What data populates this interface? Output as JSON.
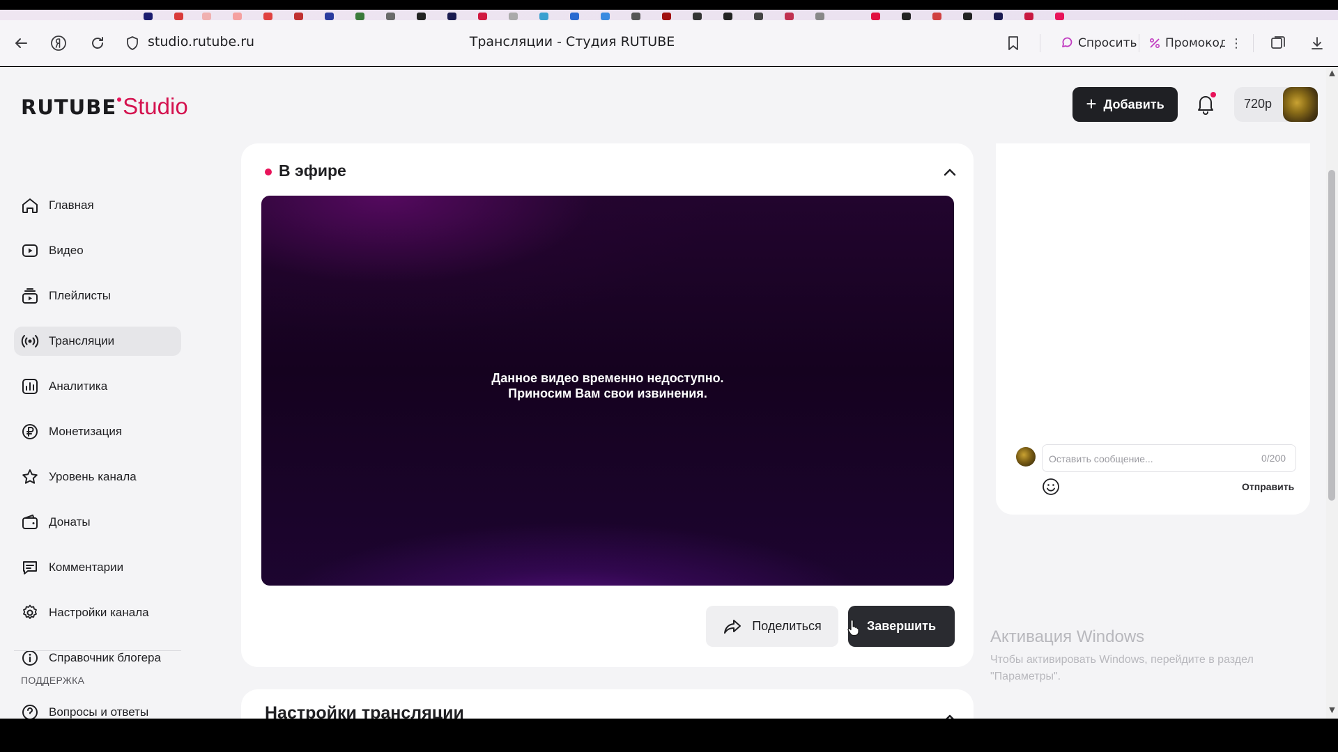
{
  "browser": {
    "url": "studio.rutube.ru",
    "page_title": "Трансляции - Студия RUTUBE",
    "ask_label": "Спросить",
    "promo_label": "Промокоды"
  },
  "header": {
    "logo_main": "RUTUBE",
    "logo_studio": "Studio",
    "add_label": "Добавить",
    "quality": "720p"
  },
  "sidebar": {
    "items": [
      {
        "label": "Главная",
        "icon": "home-icon"
      },
      {
        "label": "Видео",
        "icon": "video-icon"
      },
      {
        "label": "Плейлисты",
        "icon": "playlist-icon"
      },
      {
        "label": "Трансляции",
        "icon": "broadcast-icon",
        "active": true
      },
      {
        "label": "Аналитика",
        "icon": "analytics-icon"
      },
      {
        "label": "Монетизация",
        "icon": "ruble-icon"
      },
      {
        "label": "Уровень канала",
        "icon": "star-icon"
      },
      {
        "label": "Донаты",
        "icon": "wallet-icon"
      },
      {
        "label": "Комментарии",
        "icon": "comment-icon"
      },
      {
        "label": "Настройки канала",
        "icon": "gear-icon"
      },
      {
        "label": "Справочник блогера",
        "icon": "info-icon"
      }
    ],
    "support_heading": "ПОДДЕРЖКА",
    "faq_label": "Вопросы и ответы"
  },
  "live": {
    "title": "В эфире",
    "message_line1": "Данное видео временно недоступно.",
    "message_line2": "Приносим Вам свои извинения.",
    "share_label": "Поделиться",
    "finish_label": "Завершить"
  },
  "settings": {
    "title": "Настройки трансляции"
  },
  "chat": {
    "placeholder": "Оставить сообщение...",
    "counter": "0/200",
    "send_label": "Отправить"
  },
  "watermark": {
    "title": "Активация Windows",
    "text": "Чтобы активировать Windows, перейдите в раздел \"Параметры\"."
  },
  "colors": {
    "accent": "#e8135a",
    "dark_button": "#1f2024",
    "active_nav": "#e6e6e9"
  }
}
